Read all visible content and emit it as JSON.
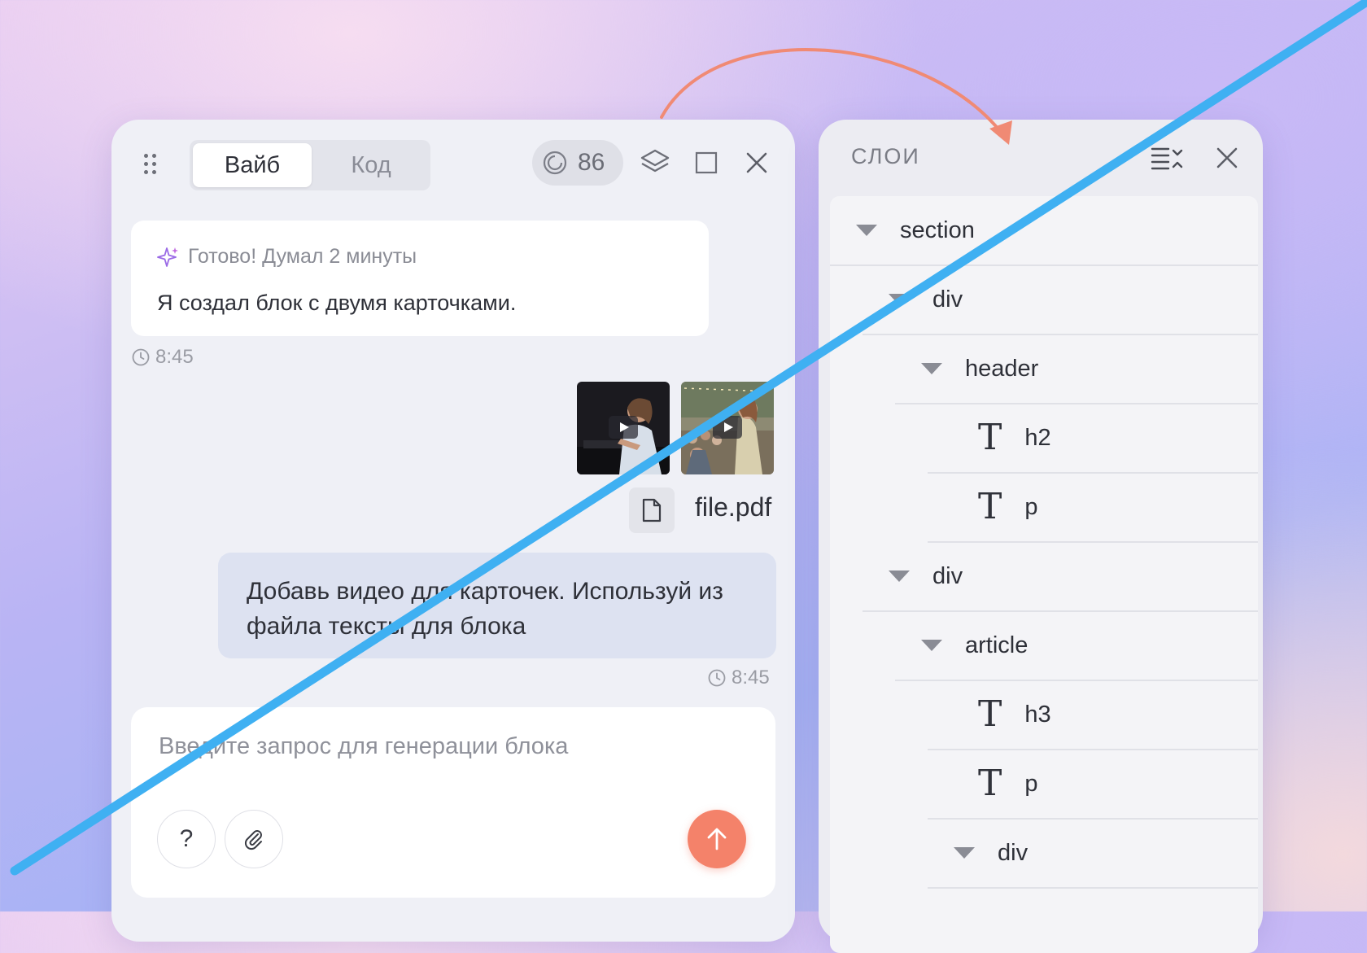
{
  "chat": {
    "tabs": [
      {
        "label": "Вайб",
        "active": true
      },
      {
        "label": "Код",
        "active": false
      }
    ],
    "credits": "86",
    "messages": [
      {
        "role": "assistant",
        "status": "Готово! Думал 2 минуты",
        "text": "Я создал блок с двумя карточками.",
        "time": "8:45"
      },
      {
        "role": "user",
        "text": "Добавь видео для карточек. Используй из файла тексты для блока",
        "time": "8:45"
      }
    ],
    "attachments": {
      "videos": [
        "video-pianist",
        "video-singer"
      ],
      "file": "file.pdf"
    },
    "composer": {
      "placeholder": "Введите запрос для генерации блока",
      "help_label": "?"
    },
    "icons": [
      "drag-handle-icon",
      "credits-icon",
      "layers-icon",
      "expand-icon",
      "close-icon",
      "sparkle-icon",
      "clock-icon",
      "file-icon",
      "paperclip-icon",
      "arrow-up-icon"
    ]
  },
  "layers": {
    "title": "СЛОИ",
    "icons": [
      "collapse-all-icon",
      "close-icon"
    ],
    "tree": [
      {
        "label": "section",
        "kind": "element",
        "depth": 0
      },
      {
        "label": "div",
        "kind": "element",
        "depth": 1
      },
      {
        "label": "header",
        "kind": "element",
        "depth": 2
      },
      {
        "label": "h2",
        "kind": "text",
        "depth": 3
      },
      {
        "label": "p",
        "kind": "text",
        "depth": 3
      },
      {
        "label": "div",
        "kind": "element",
        "depth": 1
      },
      {
        "label": "article",
        "kind": "element",
        "depth": 2
      },
      {
        "label": "h3",
        "kind": "text",
        "depth": 3
      },
      {
        "label": "p",
        "kind": "text",
        "depth": 3
      },
      {
        "label": "div",
        "kind": "element",
        "depth": 3
      }
    ]
  },
  "colors": {
    "accent": "#f4826a",
    "diagonal_line": "#3fb0f2",
    "arrow": "#f08a74"
  }
}
